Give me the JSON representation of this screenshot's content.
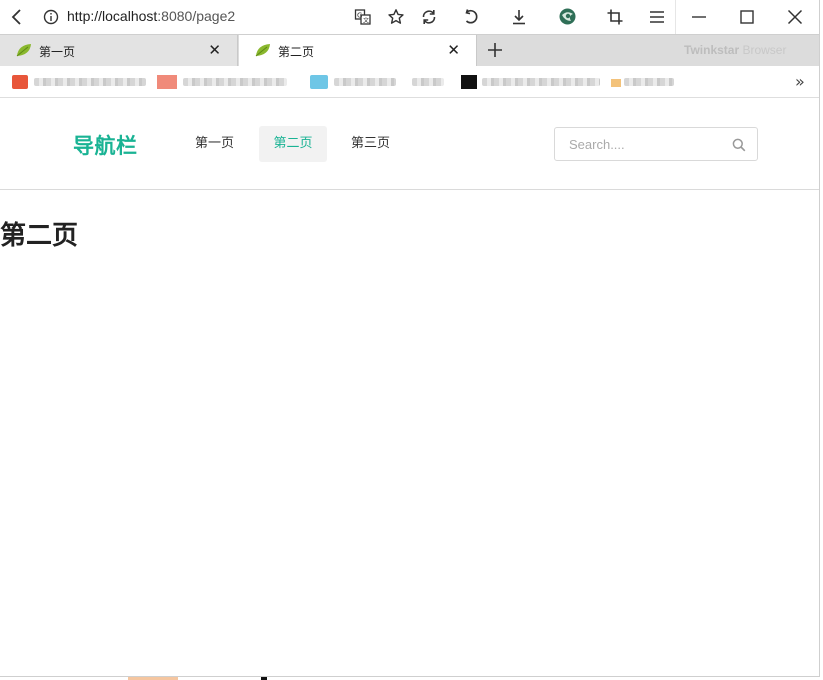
{
  "browser": {
    "url": "http://localhost:8080/page2",
    "url_host": "http://localhost",
    "url_rest": ":8080/page2",
    "brand_bold": "Twinkstar",
    "brand_light": " Browser",
    "tabs": [
      {
        "title": "第一页",
        "active": false,
        "close": "✕"
      },
      {
        "title": "第二页",
        "active": true,
        "close": "✕"
      }
    ],
    "more_bookmarks": "»",
    "icons": {
      "back": "back-arrow-icon",
      "info": "info-icon",
      "translate": "translate-icon",
      "star": "star-icon",
      "refresh": "refresh-icon",
      "undo": "undo-icon",
      "download": "download-icon",
      "extension": "extension-icon",
      "crop": "crop-icon",
      "menu": "hamburger-menu-icon",
      "minimize": "minimize-icon",
      "maximize": "maximize-icon",
      "close": "close-icon",
      "new_tab": "plus-icon",
      "leaf": "leaf-favicon-icon"
    }
  },
  "page": {
    "logo": "导航栏",
    "nav": [
      {
        "label": "第一页",
        "active": false
      },
      {
        "label": "第二页",
        "active": true
      },
      {
        "label": "第三页",
        "active": false
      }
    ],
    "search": {
      "placeholder": "Search...."
    },
    "heading": "第二页",
    "colors": {
      "accent": "#1ab394",
      "active_bg": "#f2f2f2",
      "text": "#333333"
    }
  }
}
